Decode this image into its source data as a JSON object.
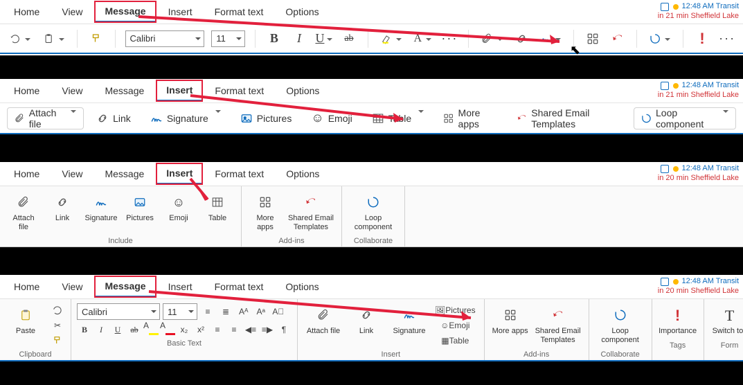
{
  "common": {
    "tabs": [
      "Home",
      "View",
      "Message",
      "Insert",
      "Format text",
      "Options"
    ],
    "status": {
      "line1": "12:48 AM Transit",
      "line2a": "in 21 min Sheffield Lake",
      "line2b": "in 20 min Sheffield Lake"
    }
  },
  "view1": {
    "activeTab": "Message",
    "font": "Calibri",
    "size": "11",
    "buttons": {
      "bold": "B",
      "italic": "I",
      "underline": "U",
      "strike": "ab",
      "more": "···",
      "moredots2": "···"
    }
  },
  "view2": {
    "activeTab": "Insert",
    "items": {
      "attach": "Attach file",
      "link": "Link",
      "signature": "Signature",
      "pictures": "Pictures",
      "emoji": "Emoji",
      "table": "Table",
      "moreapps": "More apps",
      "set": "Shared Email Templates",
      "loop": "Loop component"
    }
  },
  "view3": {
    "activeTab": "Insert",
    "btns": {
      "attach": "Attach file",
      "link": "Link",
      "signature": "Signature",
      "pictures": "Pictures",
      "emoji": "Emoji",
      "table": "Table",
      "moreapps": "More apps",
      "set": "Shared Email Templates",
      "loop": "Loop component"
    },
    "groups": {
      "include": "Include",
      "addins": "Add-ins",
      "collaborate": "Collaborate"
    }
  },
  "view4": {
    "activeTab": "Message",
    "font": "Calibri",
    "size": "11",
    "paste": "Paste",
    "groups": {
      "clipboard": "Clipboard",
      "basictext": "Basic Text",
      "insert": "Insert",
      "addins": "Add-ins",
      "collaborate": "Collaborate",
      "tags": "Tags",
      "form": "Form"
    },
    "btns": {
      "attach": "Attach file",
      "link": "Link",
      "signature": "Signature",
      "pictures": "Pictures",
      "emoji": "Emoji",
      "table": "Table",
      "moreapps": "More apps",
      "set": "Shared Email Templates",
      "loop": "Loop component",
      "importance": "Importance",
      "switch": "Switch to text"
    }
  }
}
